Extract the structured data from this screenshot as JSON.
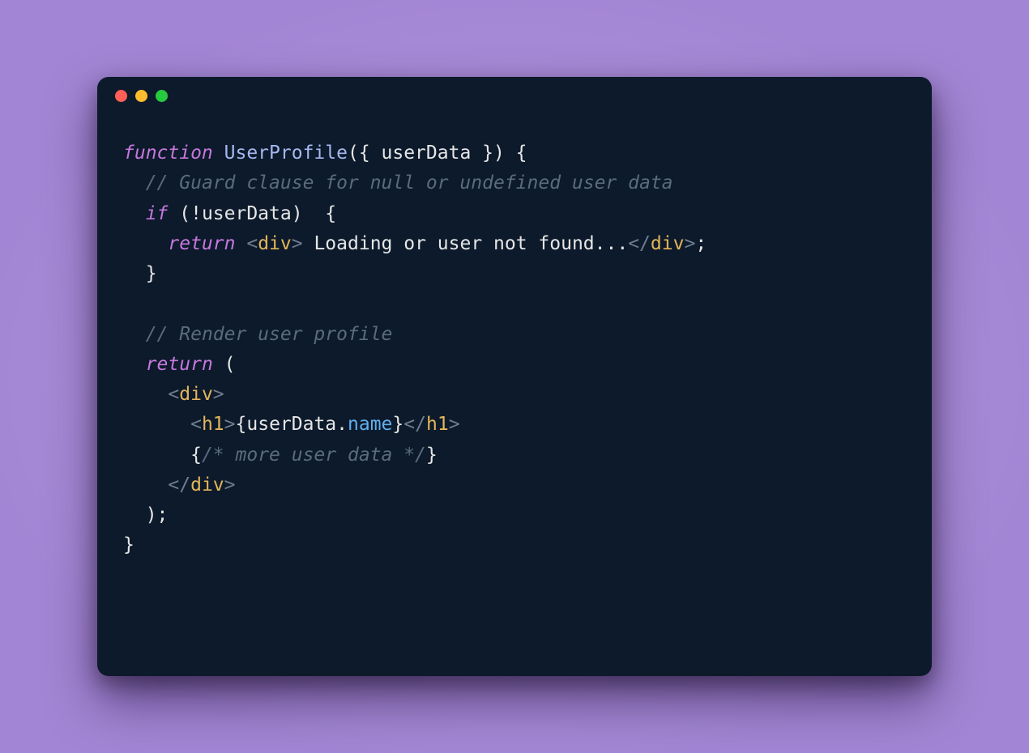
{
  "window_controls": {
    "close": "close",
    "minimize": "minimize",
    "zoom": "zoom"
  },
  "code": {
    "kw_function": "function",
    "fn_name": "UserProfile",
    "sig_open": "({ ",
    "param": "userData",
    "sig_close": " }) {",
    "comment1": "// Guard clause for null or undefined user data",
    "kw_if": "if",
    "if_cond": " (!userData)  {",
    "kw_return1": "return",
    "ret_sp": " ",
    "ang_o": "<",
    "ang_c": ">",
    "slash": "/",
    "tag_div": "div",
    "loading_text": " Loading or user not found...",
    "semicolon": ";",
    "close_brace": "}",
    "comment2": "// Render user profile",
    "kw_return2": "return",
    "paren_open": " (",
    "tag_h1": "h1",
    "lb": "{",
    "rb": "}",
    "expr_obj": "userData",
    "dot": ".",
    "expr_prop": "name",
    "comment_jsx": "/* more user data */",
    "paren_close": ");",
    "final_close": "}"
  }
}
